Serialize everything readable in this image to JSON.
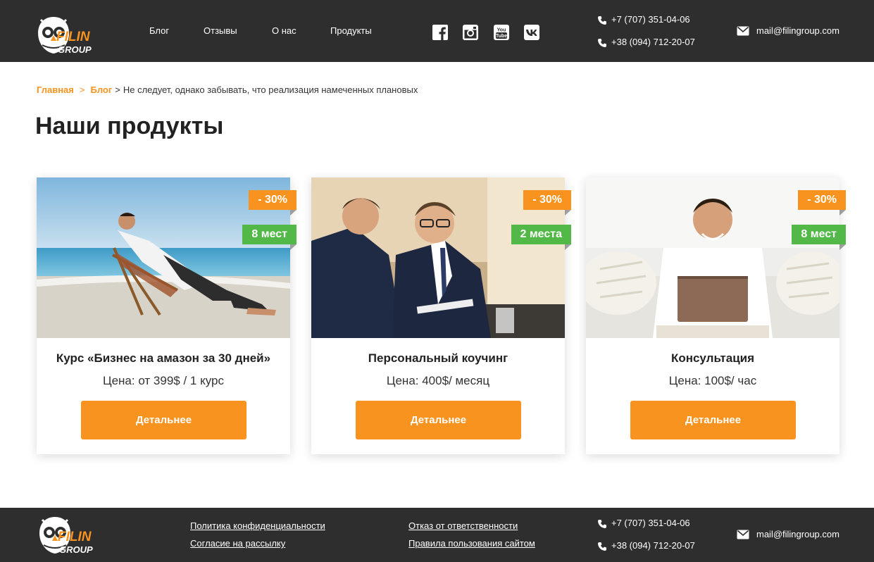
{
  "logo": {
    "word1": "FILIN",
    "word2": "GROUP"
  },
  "nav": [
    {
      "label": "Блог"
    },
    {
      "label": "Отзывы"
    },
    {
      "label": "О нас"
    },
    {
      "label": "Продукты"
    }
  ],
  "social": [
    "facebook-icon",
    "instagram-icon",
    "youtube-icon",
    "vk-icon"
  ],
  "contacts": {
    "phone1": "+7 (707) 351-04-06",
    "phone2": "+38 (094) 712-20-07",
    "email": "mail@filingroup.com"
  },
  "breadcrumb": {
    "home": "Главная",
    "sep": ">",
    "blog": "Блог",
    "current": "Не следует, однако забывать, что реализация намеченных плановых"
  },
  "page_title": "Наши продукты",
  "products": [
    {
      "title": "Курс «Бизнес на амазон за 30 дней»",
      "price": "Цена: от 399$ / 1 курс",
      "discount": "- 30%",
      "seats": "8 мест",
      "button": "Детальнее"
    },
    {
      "title": "Персональный коучинг",
      "price": "Цена: 400$/ месяц",
      "discount": "- 30%",
      "seats": "2 места",
      "button": "Детальнее"
    },
    {
      "title": "Консультация",
      "price": "Цена: 100$/ час",
      "discount": "- 30%",
      "seats": "8 мест",
      "button": "Детальнее"
    }
  ],
  "footer": {
    "privacy": "Политика конфиденциальности",
    "subscribe": "Согласие на рассылку",
    "disclaimer": "Отказ от ответственности",
    "terms": "Правила пользования сайтом"
  },
  "colors": {
    "accent": "#f7931e",
    "green": "#52b948",
    "dark": "#2e2e2e"
  }
}
